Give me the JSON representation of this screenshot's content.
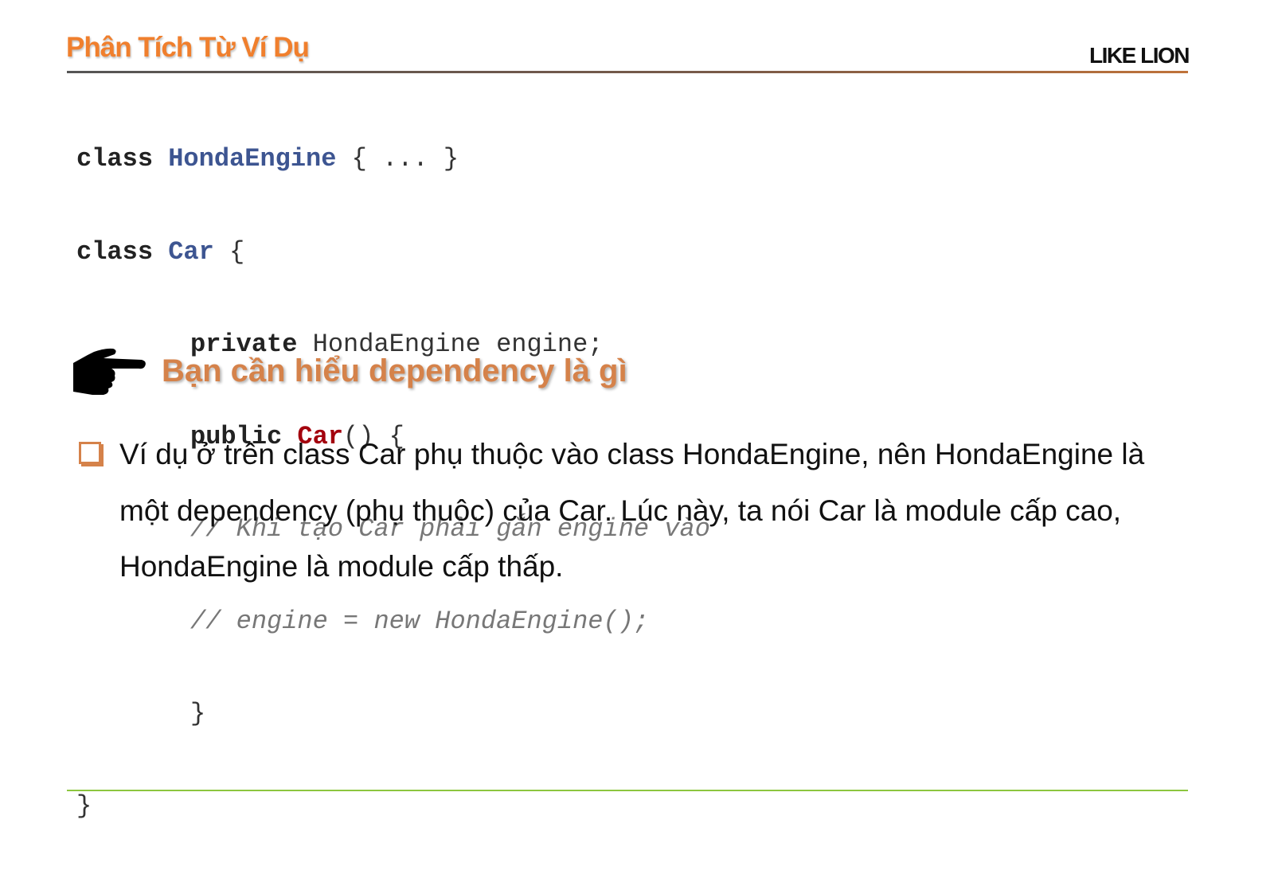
{
  "header": {
    "title": "Phân Tích Từ Ví Dụ",
    "logo": "LIKE LION"
  },
  "code": {
    "l1_kw": "class ",
    "l1_cls": "HondaEngine",
    "l1_rest": " { ... }",
    "l2_kw": "class ",
    "l2_cls": "Car",
    "l2_rest": " {",
    "l3_kw": "private",
    "l3_rest": " HondaEngine engine;",
    "l4_kw": "public ",
    "l4_cls": "Car",
    "l4_rest": "() {",
    "l5": "// Khi tạo Car phải gắn engine vào",
    "l6": "// engine = new HondaEngine();",
    "l7": "}",
    "l8": "}"
  },
  "section": {
    "heading": "Bạn cần hiểu dependency là gì",
    "icon": "pointing-hand-icon"
  },
  "bullets": [
    {
      "icon": "checkbox-square-icon",
      "text": "Ví dụ ở trên class Car phụ thuộc vào class HondaEngine, nên HondaEngine là một dependency (phụ thuộc) của Car. Lúc này, ta nói Car là module cấp cao, HondaEngine là module cấp thấp."
    }
  ],
  "colors": {
    "title": "#f07f2d",
    "heading": "#d5824a",
    "class_name": "#3d5591",
    "constructor": "#a3000d",
    "footer_line": "#8cc63f"
  }
}
